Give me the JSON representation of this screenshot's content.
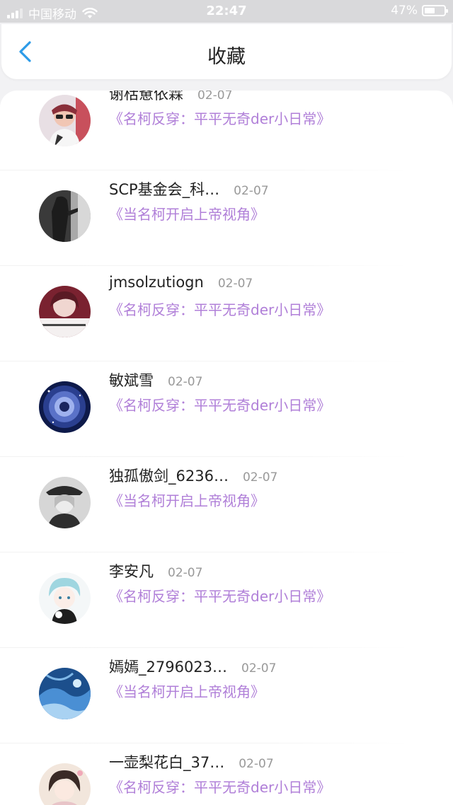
{
  "status_bar": {
    "carrier": "中国移动",
    "time": "22:47",
    "battery": "47%",
    "battery_level": 0.47,
    "icons": [
      "signal-icon",
      "wifi-icon",
      "battery-icon"
    ],
    "color": "#ffffff"
  },
  "header": {
    "title": "收藏",
    "back_icon": "chevron-left-icon",
    "accent": "#2c9be8"
  },
  "items": [
    {
      "user": "谢栝惫依霖",
      "date": "02-07",
      "novel": "《名柯反穿：平平无奇der小日常》"
    },
    {
      "user": "SCP基金会_科…",
      "date": "02-07",
      "novel": "《当名柯开启上帝视角》"
    },
    {
      "user": "jmsolzutiogn",
      "date": "02-07",
      "novel": "《名柯反穿：平平无奇der小日常》"
    },
    {
      "user": "敏斌雪",
      "date": "02-07",
      "novel": "《名柯反穿：平平无奇der小日常》"
    },
    {
      "user": "独孤傲剑_6236…",
      "date": "02-07",
      "novel": "《当名柯开启上帝视角》"
    },
    {
      "user": "李安凡",
      "date": "02-07",
      "novel": "《名柯反穿：平平无奇der小日常》"
    },
    {
      "user": "嫣嫣_2796023…",
      "date": "02-07",
      "novel": "《当名柯开启上帝视角》"
    },
    {
      "user": "一壶梨花白_37…",
      "date": "02-07",
      "novel": "《名柯反穿：平平无奇der小日常》"
    }
  ],
  "colors": {
    "novel_title": "#b07fd8",
    "date": "#999999",
    "username": "#222222",
    "background": "#f2f2f4"
  }
}
